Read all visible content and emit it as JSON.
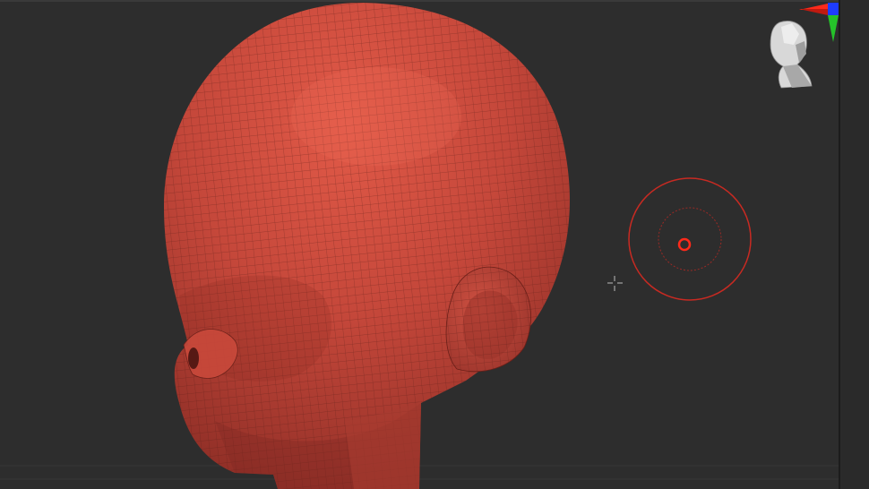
{
  "app": {
    "viewport_background": "#2d2d2d"
  },
  "mesh": {
    "material_color": "#c8473a"
  },
  "brush": {
    "color": "#c82a22"
  },
  "navigation": {
    "gizmo_icon": "head-orientation-gizmo-icon",
    "axis_colors": [
      "#ff2a1a",
      "#1e3cff",
      "#25c22a"
    ]
  },
  "cursor": {
    "icon": "crosshair-cursor-icon"
  }
}
